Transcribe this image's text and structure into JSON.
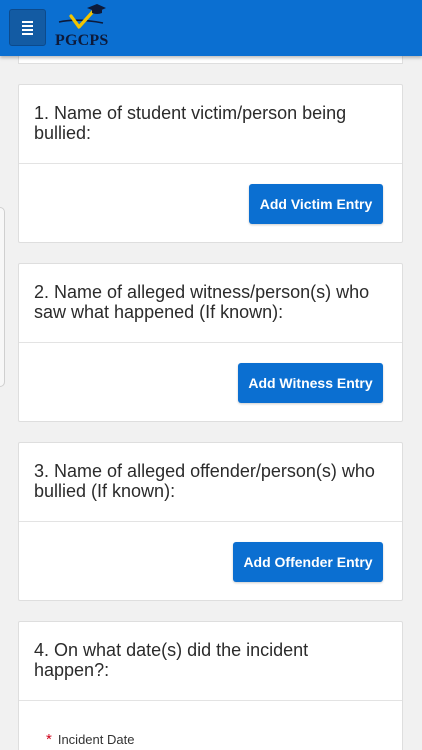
{
  "header": {
    "menu_icon": "hamburger-menu-icon",
    "logo_text": "PGCPS",
    "logo_icon": "checkmark-graduation-cap-icon"
  },
  "cards": [
    {
      "number": "1.",
      "question": "Name of student victim/person being bullied:",
      "button_label": "Add Victim Entry"
    },
    {
      "number": "2.",
      "question": "Name of alleged witness/person(s) who saw what happened (If known):",
      "button_label": "Add Witness Entry"
    },
    {
      "number": "3.",
      "question": "Name of alleged offender/person(s) who bullied (If known):",
      "button_label": "Add Offender Entry"
    },
    {
      "number": "4.",
      "question": "On what date(s) did the incident happen?:",
      "field_label": "Incident Date",
      "required_mark": "*"
    }
  ],
  "colors": {
    "primary": "#0b6fd1",
    "background": "#f1f1f1",
    "required": "#d0021b"
  }
}
